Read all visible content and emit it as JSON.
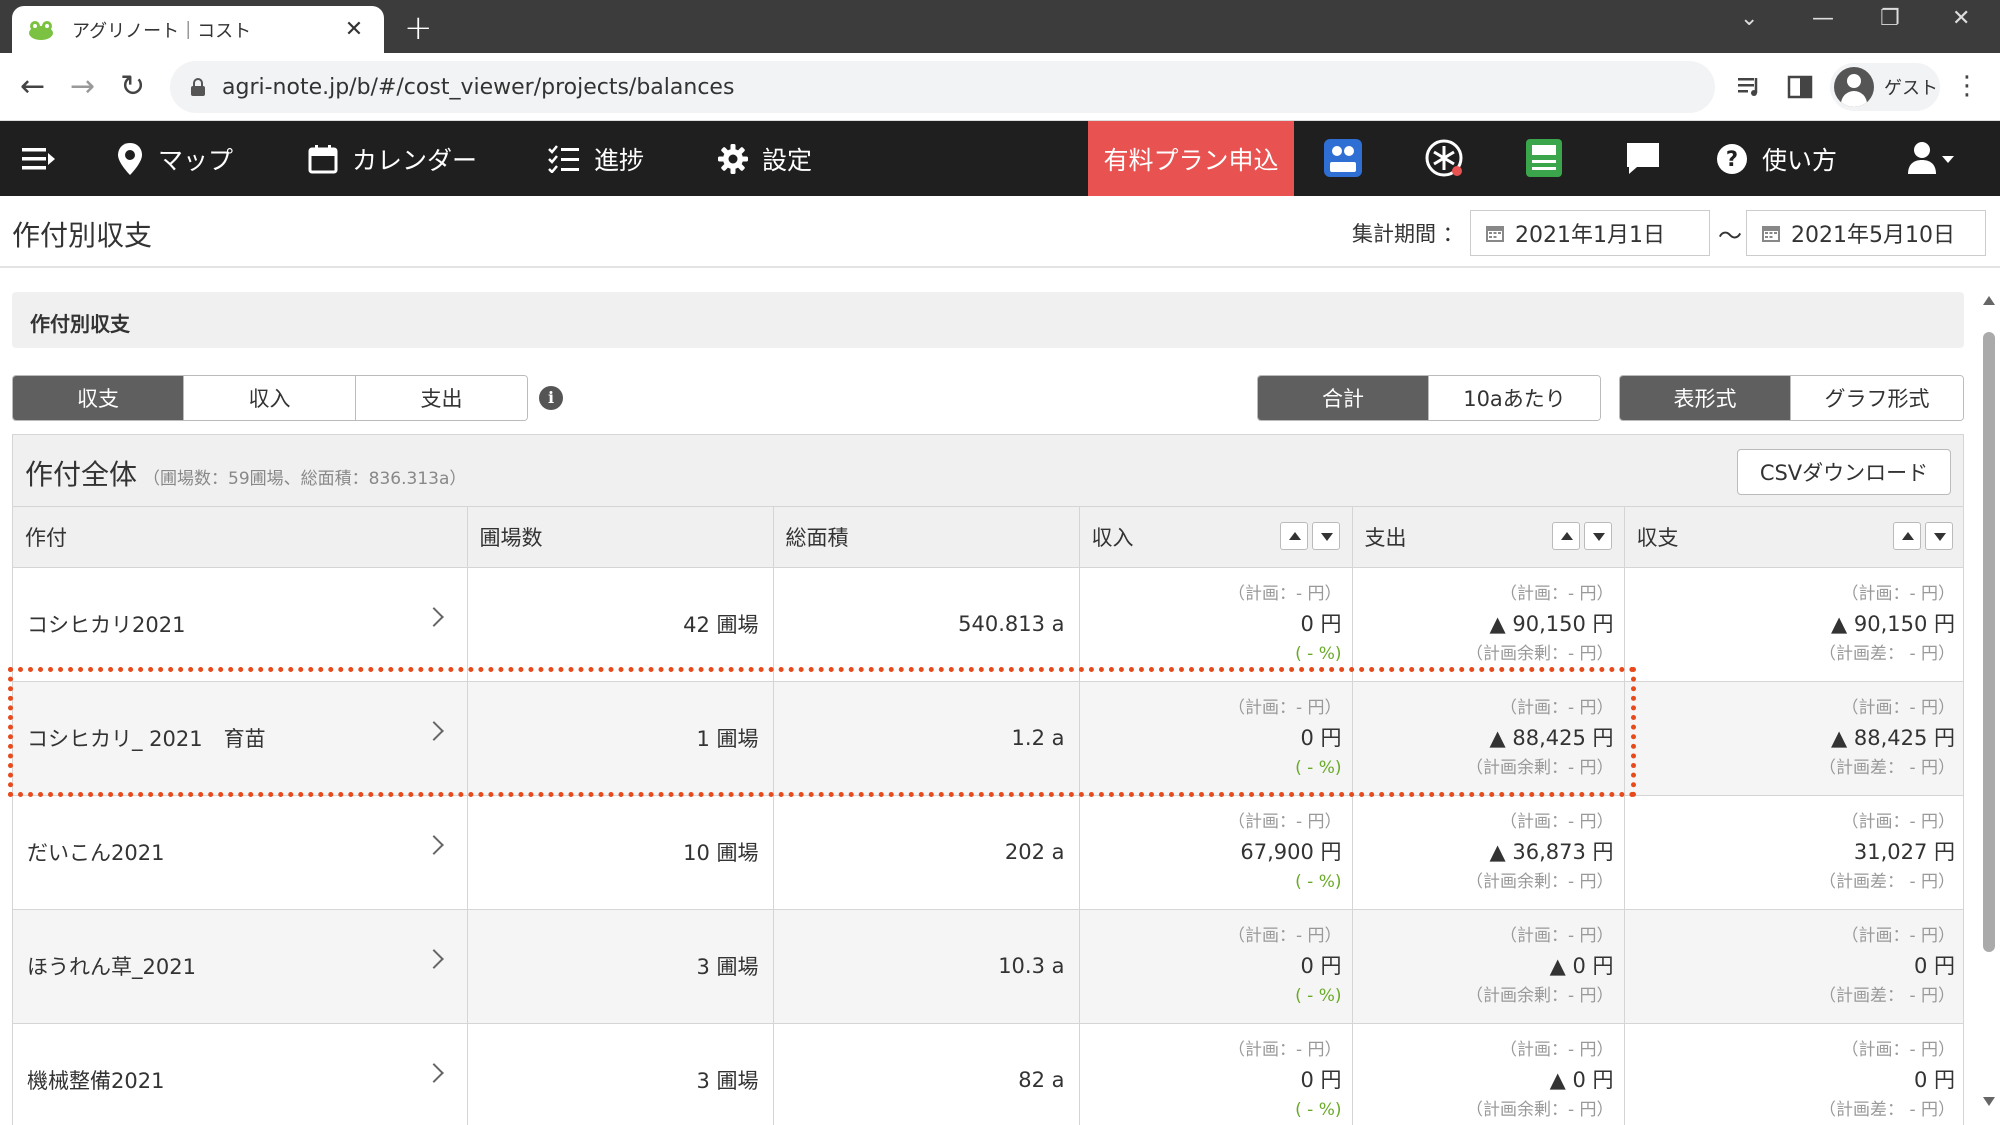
{
  "browser": {
    "tab_title": "アグリノート｜コスト",
    "url": "agri-note.jp/b/#/cost_viewer/projects/balances",
    "profile_label": "ゲスト"
  },
  "nav": {
    "map": "マップ",
    "calendar": "カレンダー",
    "progress": "進捗",
    "settings": "設定",
    "paid_plan": "有料プラン申込",
    "help": "使い方"
  },
  "header": {
    "title": "作付別収支",
    "period_label": "集計期間 ：",
    "start_date": "2021年1月1日",
    "tilde": "〜",
    "end_date": "2021年5月10日"
  },
  "section": {
    "title": "作付別収支"
  },
  "tabs_type": [
    "収支",
    "収入",
    "支出"
  ],
  "tabs_unit": [
    "合計",
    "10aあたり"
  ],
  "tabs_view": [
    "表形式",
    "グラフ形式"
  ],
  "panel": {
    "title": "作付全体",
    "subtitle": "（圃場数：59圃場、総面積：836.313a）",
    "csv_label": "CSVダウンロード"
  },
  "columns": [
    "作付",
    "圃場数",
    "総面積",
    "収入",
    "支出",
    "収支"
  ],
  "rows": [
    {
      "crop": "コシヒカリ2021",
      "fields": "42 圃場",
      "area": "540.813 a",
      "income_plan": "（計画：- 円）",
      "income": "0 円",
      "income_pct": "( - %)",
      "expense_plan": "（計画：- 円）",
      "expense": "▲ 90,150 円",
      "expense_rem": "（計画余剰：- 円）",
      "balance_plan": "（計画：- 円）",
      "balance": "▲ 90,150 円",
      "balance_diff": "（計画差： - 円）"
    },
    {
      "crop": "コシヒカリ_ 2021　育苗",
      "fields": "1 圃場",
      "area": "1.2 a",
      "income_plan": "（計画：- 円）",
      "income": "0 円",
      "income_pct": "( - %)",
      "expense_plan": "（計画：- 円）",
      "expense": "▲ 88,425 円",
      "expense_rem": "（計画余剰：- 円）",
      "balance_plan": "（計画：- 円）",
      "balance": "▲ 88,425 円",
      "balance_diff": "（計画差： - 円）"
    },
    {
      "crop": "だいこん2021",
      "fields": "10 圃場",
      "area": "202 a",
      "income_plan": "（計画：- 円）",
      "income": "67,900 円",
      "income_pct": "( - %)",
      "expense_plan": "（計画：- 円）",
      "expense": "▲ 36,873 円",
      "expense_rem": "（計画余剰：- 円）",
      "balance_plan": "（計画：- 円）",
      "balance": "31,027 円",
      "balance_diff": "（計画差： - 円）"
    },
    {
      "crop": "ほうれん草_2021",
      "fields": "3 圃場",
      "area": "10.3 a",
      "income_plan": "（計画：- 円）",
      "income": "0 円",
      "income_pct": "( - %)",
      "expense_plan": "（計画：- 円）",
      "expense": "▲ 0 円",
      "expense_rem": "（計画余剰：- 円）",
      "balance_plan": "（計画：- 円）",
      "balance": "0 円",
      "balance_diff": "（計画差： - 円）"
    },
    {
      "crop": "機械整備2021",
      "fields": "3 圃場",
      "area": "82 a",
      "income_plan": "（計画：- 円）",
      "income": "0 円",
      "income_pct": "( - %)",
      "expense_plan": "（計画：- 円）",
      "expense": "▲ 0 円",
      "expense_rem": "（計画余剰：- 円）",
      "balance_plan": "（計画：- 円）",
      "balance": "0 円",
      "balance_diff": "（計画差： - 円）"
    }
  ],
  "colors": {
    "nav_bg": "#1f1f1f",
    "paid_plan_bg": "#e85250",
    "active_tab_bg": "#5f5f5f",
    "pct_green": "#6aaa2a",
    "highlight_red": "#e84a1c"
  },
  "icons": {
    "menu": "menu-toggle-icon",
    "map": "map-pin-icon",
    "calendar": "calendar-icon",
    "progress": "checklist-icon",
    "settings": "gear-icon",
    "help": "help-circle-icon",
    "user": "user-icon"
  }
}
